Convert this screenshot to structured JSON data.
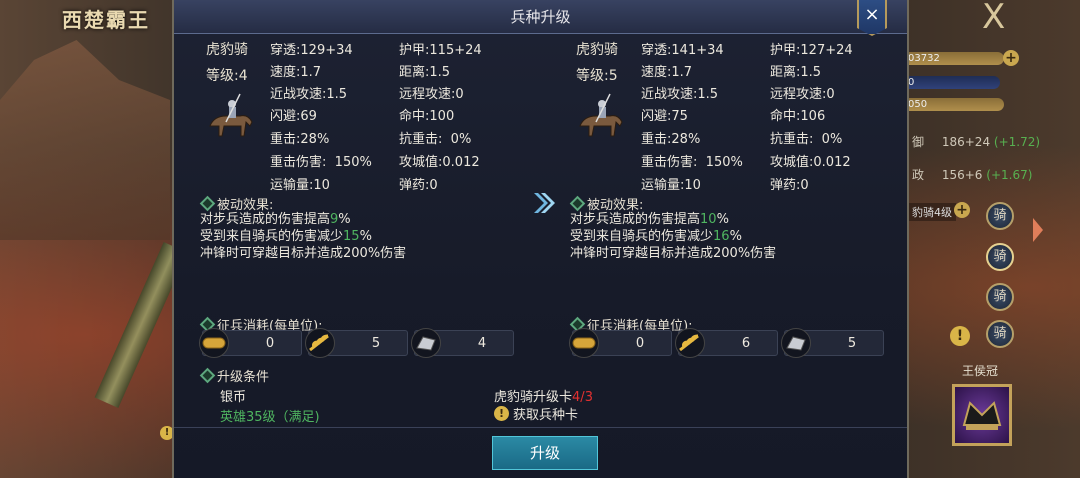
{
  "background": {
    "title": "西楚霸王",
    "close_glyph": "X",
    "bar1_text": "03732",
    "bar2_text": "0",
    "bar3_text": "050",
    "stat_def_label": "御",
    "stat_def_value": "186+24",
    "stat_def_bonus": "(+1.72)",
    "stat_pol_label": "政",
    "stat_pol_value": "156+6",
    "stat_pol_bonus": "(+1.67)",
    "troop_label": "豹骑4级",
    "hero_name": "王侯冠"
  },
  "dialog": {
    "title": "兵种升级",
    "close_icon": "×",
    "upgrade_button": "升级"
  },
  "left": {
    "unit_name": "虎豹骑",
    "unit_level": "等级:4",
    "stats": [
      {
        "label": "穿透",
        "value": "129+34"
      },
      {
        "label": "护甲",
        "value": "115+24"
      },
      {
        "label": "速度",
        "value": "1.7"
      },
      {
        "label": "距离",
        "value": "1.5"
      },
      {
        "label": "近战攻速",
        "value": "1.5"
      },
      {
        "label": "远程攻速",
        "value": "0"
      },
      {
        "label": "闪避",
        "value": "69"
      },
      {
        "label": "命中",
        "value": "100"
      },
      {
        "label": "重击",
        "value": "28%"
      },
      {
        "label": "抗重击",
        "value": "  0%"
      },
      {
        "label": "重击伤害",
        "value": "  150%"
      },
      {
        "label": "攻城值",
        "value": "0.012"
      },
      {
        "label": "运输量",
        "value": "10"
      },
      {
        "label": "弹药",
        "value": "0"
      }
    ],
    "passive_title": "被动效果:",
    "passive_1_pre": "对步兵造成的伤害提高",
    "passive_1_val": "9",
    "passive_1_post": "%",
    "passive_2_pre": "受到来自骑兵的伤害减少",
    "passive_2_val": "15",
    "passive_2_post": "%",
    "passive_3": "冲锋时可穿越目标并造成200%伤害",
    "cost_title": "征兵消耗(每单位):",
    "costs": [
      {
        "icon": "gold-ingot-icon",
        "value": "0"
      },
      {
        "icon": "wheat-icon",
        "value": "5"
      },
      {
        "icon": "iron-icon",
        "value": "4"
      }
    ],
    "cond_title": "升级条件",
    "cond_silver": "银币",
    "cond_hero": "英雄35级（满足)"
  },
  "right": {
    "unit_name": "虎豹骑",
    "unit_level": "等级:5",
    "stats": [
      {
        "label": "穿透",
        "value": "141+34"
      },
      {
        "label": "护甲",
        "value": "127+24"
      },
      {
        "label": "速度",
        "value": "1.7"
      },
      {
        "label": "距离",
        "value": "1.5"
      },
      {
        "label": "近战攻速",
        "value": "1.5"
      },
      {
        "label": "远程攻速",
        "value": "0"
      },
      {
        "label": "闪避",
        "value": "75"
      },
      {
        "label": "命中",
        "value": "106"
      },
      {
        "label": "重击",
        "value": "28%"
      },
      {
        "label": "抗重击",
        "value": "  0%"
      },
      {
        "label": "重击伤害",
        "value": "  150%"
      },
      {
        "label": "攻城值",
        "value": "0.012"
      },
      {
        "label": "运输量",
        "value": "10"
      },
      {
        "label": "弹药",
        "value": "0"
      }
    ],
    "passive_title": "被动效果:",
    "passive_1_pre": "对步兵造成的伤害提高",
    "passive_1_val": "10",
    "passive_1_post": "%",
    "passive_2_pre": "受到来自骑兵的伤害减少",
    "passive_2_val": "16",
    "passive_2_post": "%",
    "passive_3": "冲锋时可穿越目标并造成200%伤害",
    "cost_title": "征兵消耗(每单位):",
    "costs": [
      {
        "icon": "gold-ingot-icon",
        "value": "0"
      },
      {
        "icon": "wheat-icon",
        "value": "6"
      },
      {
        "icon": "iron-icon",
        "value": "5"
      }
    ],
    "card_label": "虎豹骑升级卡",
    "card_have": "4",
    "card_sep": "/",
    "card_need": "3",
    "get_card": "获取兵种卡"
  },
  "colors": {
    "green": "#4fb560",
    "red": "#e23030",
    "panel": "#1b2030",
    "button": "#1f7893"
  }
}
